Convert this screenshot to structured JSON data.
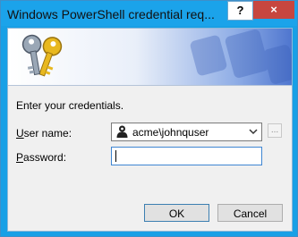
{
  "window": {
    "title": "Windows PowerShell credential req...",
    "help_label": "?",
    "close_label": "×"
  },
  "form": {
    "prompt": "Enter your credentials.",
    "username_label_accel": "U",
    "username_label_rest": "ser name:",
    "username_value": "acme\\johnquser",
    "password_label_accel": "P",
    "password_label_rest": "assword:",
    "password_value": "",
    "browse_label": "..."
  },
  "buttons": {
    "ok_label": "OK",
    "cancel_label": "Cancel"
  },
  "icons": {
    "banner": "keys-icon",
    "user": "user-icon",
    "dropdown": "chevron-down-icon"
  },
  "colors": {
    "title_bar": "#1ba3ea",
    "close_button": "#c7463f",
    "banner_gradient_end": "#4f76cf"
  }
}
